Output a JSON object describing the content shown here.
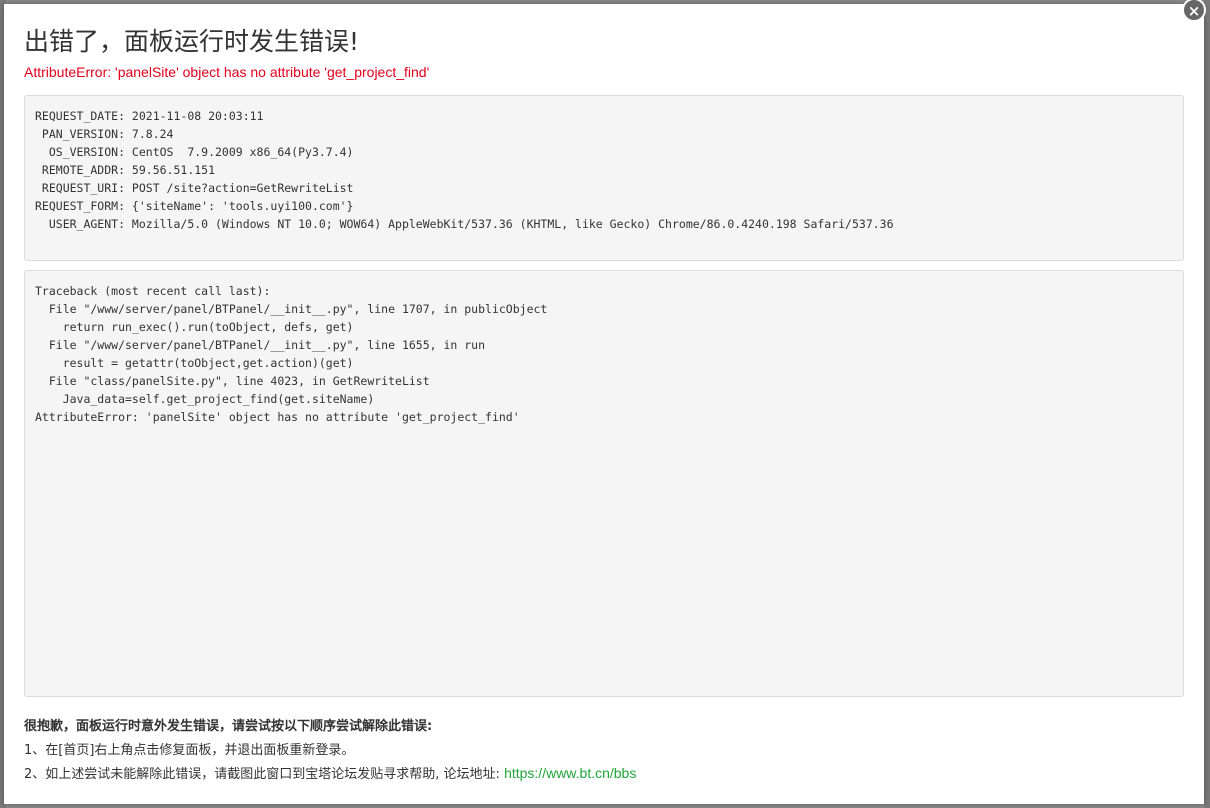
{
  "dialog": {
    "close_label": "×",
    "title": "出错了，面板运行时发生错误!",
    "error_message": "AttributeError: 'panelSite' object has no attribute 'get_project_find'"
  },
  "request_info": [
    "REQUEST_DATE: 2021-11-08 20:03:11",
    " PAN_VERSION: 7.8.24",
    "  OS_VERSION: CentOS  7.9.2009 x86_64(Py3.7.4)",
    " REMOTE_ADDR: 59.56.51.151",
    " REQUEST_URI: POST /site?action=GetRewriteList",
    "REQUEST_FORM: {'siteName': 'tools.uyi100.com'}",
    "  USER_AGENT: Mozilla/5.0 (Windows NT 10.0; WOW64) AppleWebKit/537.36 (KHTML, like Gecko) Chrome/86.0.4240.198 Safari/537.36"
  ],
  "traceback": [
    "Traceback (most recent call last):",
    "  File \"/www/server/panel/BTPanel/__init__.py\", line 1707, in publicObject",
    "    return run_exec().run(toObject, defs, get)",
    "  File \"/www/server/panel/BTPanel/__init__.py\", line 1655, in run",
    "    result = getattr(toObject,get.action)(get)",
    "  File \"class/panelSite.py\", line 4023, in GetRewriteList",
    "    Java_data=self.get_project_find(get.siteName)",
    "AttributeError: 'panelSite' object has no attribute 'get_project_find'"
  ],
  "help": {
    "heading": "很抱歉，面板运行时意外发生错误，请尝试按以下顺序尝试解除此错误:",
    "step1": "1、在[首页]右上角点击修复面板，并退出面板重新登录。",
    "step2_prefix": "2、如上述尝试未能解除此错误，请截图此窗口到宝塔论坛发贴寻求帮助, 论坛地址: ",
    "forum_url": "https://www.bt.cn/bbs"
  },
  "colors": {
    "error_red": "#e2001a",
    "link_green": "#20a53a"
  }
}
